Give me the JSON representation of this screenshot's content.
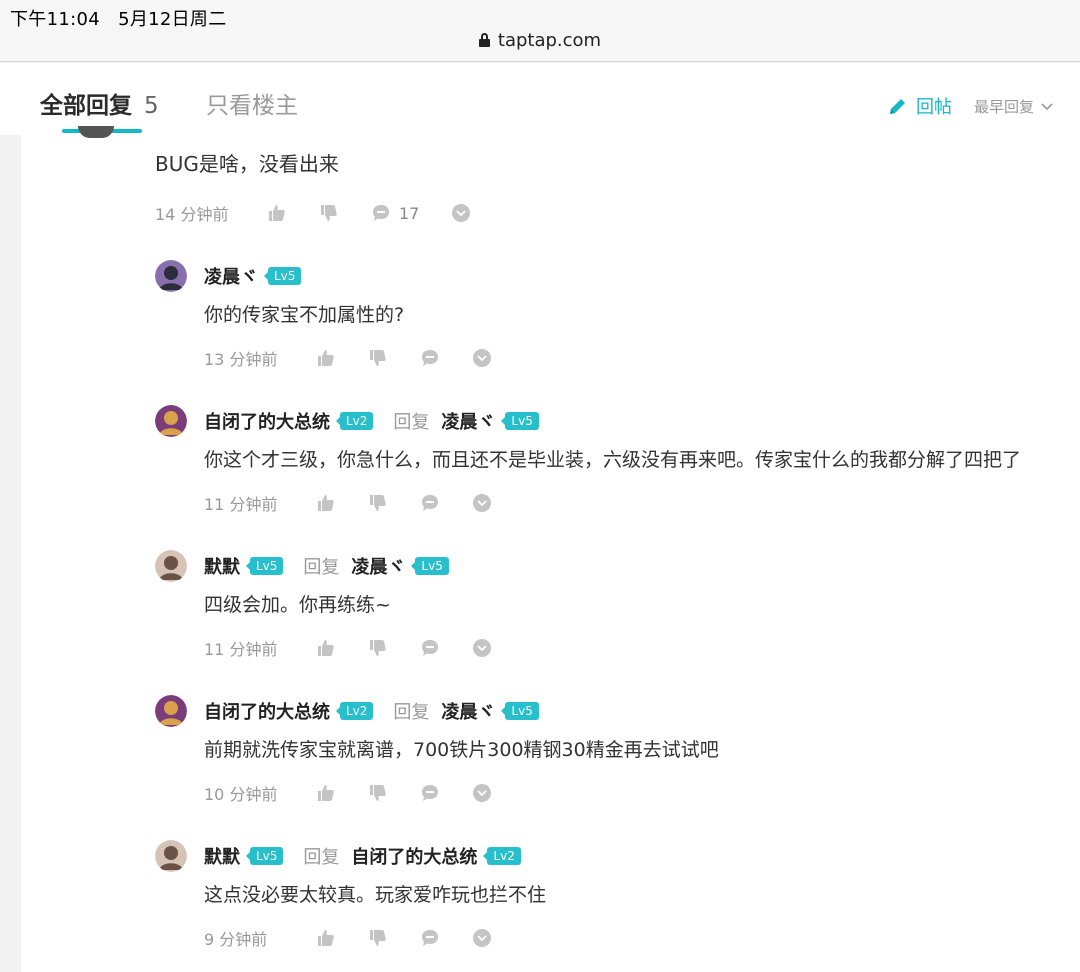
{
  "status": {
    "time": "下午11:04",
    "date": "5月12日周二",
    "url": "taptap.com"
  },
  "tabs": {
    "all_label": "全部回复",
    "all_count": "5",
    "op_only": "只看楼主",
    "reply_button": "回帖",
    "sort_label": "最早回复"
  },
  "main_reply": {
    "text": "BUG是啥，没看出来",
    "time": "14 分钟前",
    "comment_count": "17"
  },
  "reply_word": "回复",
  "comments": [
    {
      "user": "凌晨ヾ",
      "level": "Lv5",
      "reply_to": "",
      "reply_to_level": "",
      "text": "你的传家宝不加属性的?",
      "time": "13 分钟前"
    },
    {
      "user": "自闭了的大总统",
      "level": "Lv2",
      "reply_to": "凌晨ヾ",
      "reply_to_level": "Lv5",
      "text": "你这个才三级，你急什么，而且还不是毕业装，六级没有再来吧。传家宝什么的我都分解了四把了",
      "time": "11 分钟前"
    },
    {
      "user": "默默",
      "level": "Lv5",
      "reply_to": "凌晨ヾ",
      "reply_to_level": "Lv5",
      "text": "四级会加。你再练练~",
      "time": "11 分钟前"
    },
    {
      "user": "自闭了的大总统",
      "level": "Lv2",
      "reply_to": "凌晨ヾ",
      "reply_to_level": "Lv5",
      "text": "前期就洗传家宝就离谱，700铁片300精钢30精金再去试试吧",
      "time": "10 分钟前"
    },
    {
      "user": "默默",
      "level": "Lv5",
      "reply_to": "自闭了的大总统",
      "reply_to_level": "Lv2",
      "text": "这点没必要太较真。玩家爱咋玩也拦不住",
      "time": "9 分钟前"
    }
  ],
  "colors": {
    "accent": "#14b9c8",
    "level_badge": "#27bfcc"
  }
}
